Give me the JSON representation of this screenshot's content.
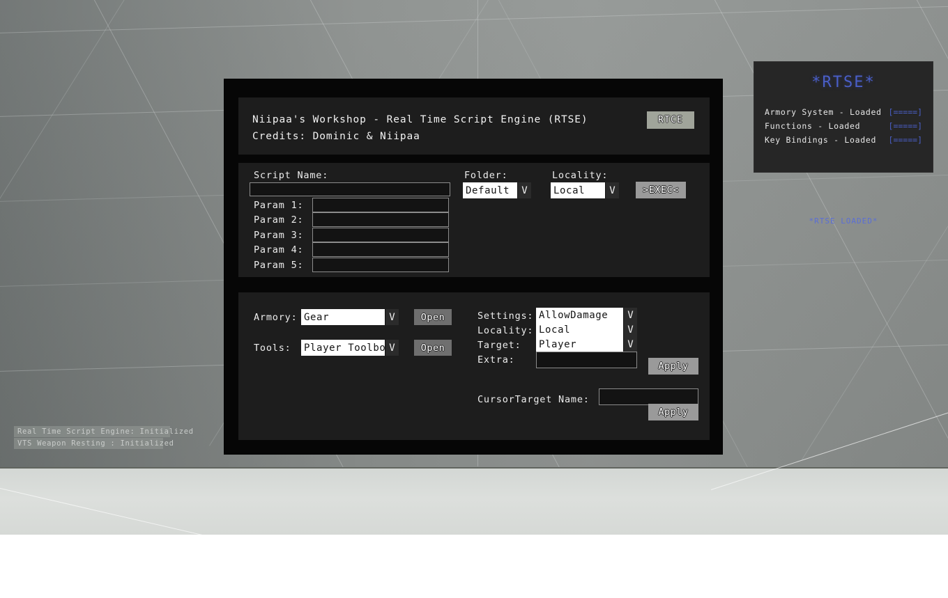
{
  "window": {
    "title_line1": "Niipaa's Workshop - Real Time Script Engine (RTSE)",
    "title_line2": "Credits: Dominic & Niipaa",
    "rtce_button": "RTCE"
  },
  "script_panel": {
    "script_name_label": "Script Name:",
    "script_name_value": "",
    "params": [
      {
        "label": "Param 1:",
        "value": ""
      },
      {
        "label": "Param 2:",
        "value": ""
      },
      {
        "label": "Param 3:",
        "value": ""
      },
      {
        "label": "Param 4:",
        "value": ""
      },
      {
        "label": "Param 5:",
        "value": ""
      }
    ],
    "folder_label": "Folder:",
    "folder_value": "Default",
    "locality_label": "Locality:",
    "locality_value": "Local",
    "exec_button": ">EXEC<",
    "dropdown_arrow": "V"
  },
  "tools_panel": {
    "armory_label": "Armory:",
    "armory_value": "Gear",
    "armory_open_button": "Open",
    "tools_label": "Tools:",
    "tools_value": "Player Toolbox",
    "tools_open_button": "Open",
    "settings_label": "Settings:",
    "settings_value": "AllowDamage",
    "locality_label": "Locality:",
    "locality_value": "Local",
    "target_label": "Target:",
    "target_value": "Player",
    "extra_label": "Extra:",
    "extra_value": "",
    "apply_button": "Apply",
    "cursor_target_label": "CursorTarget Name:",
    "cursor_target_value": "",
    "cursor_apply_button": "Apply",
    "dropdown_arrow": "V"
  },
  "hud": {
    "title": "*RTSE*",
    "rows": [
      {
        "name": "Armory System - Loaded",
        "bar": "[=====]"
      },
      {
        "name": "Functions - Loaded",
        "bar": "[=====]"
      },
      {
        "name": "Key Bindings - Loaded",
        "bar": "[=====]"
      }
    ],
    "footer": "*RTSE LOADED*"
  },
  "console": {
    "lines": [
      "Real Time Script Engine: Initialized",
      "VTS Weapon Resting : Initialized"
    ]
  },
  "colors": {
    "accent_blue": "#4a5fc8",
    "panel_bg": "#1d1d1d",
    "window_bg": "#060606",
    "button_gray": "#9a9a9a",
    "rtce_button": "#a0a49a"
  }
}
